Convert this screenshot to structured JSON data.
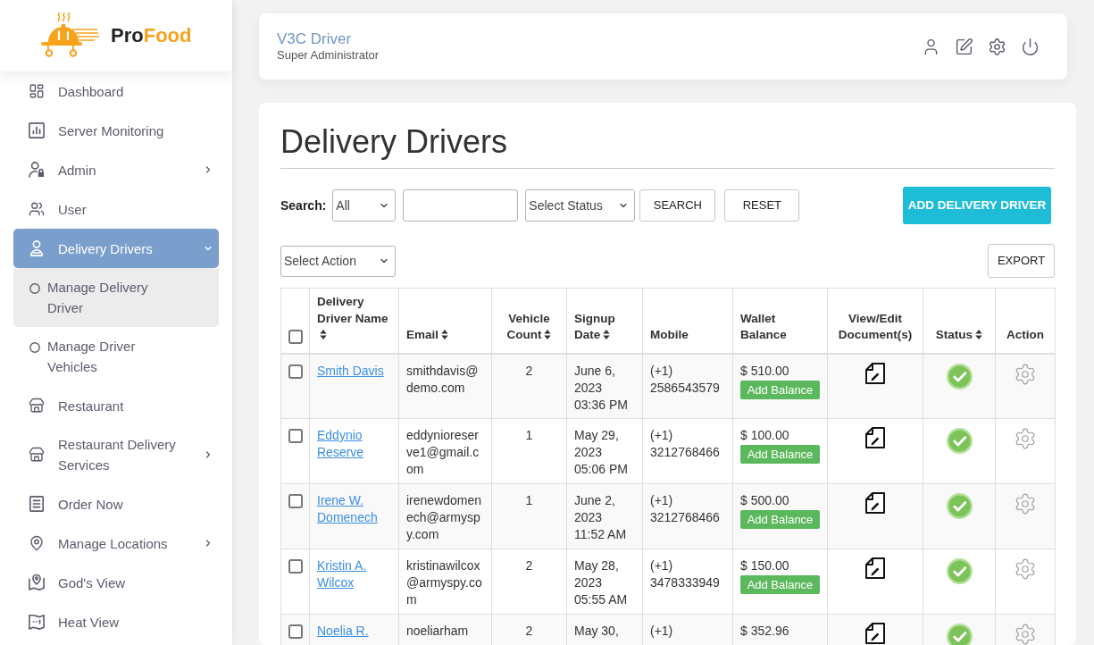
{
  "sidebar": {
    "logo": {
      "text_dark": "Pro",
      "text_accent": "Food"
    },
    "items": [
      {
        "label": "Dashboard",
        "selected": false
      },
      {
        "label": "Server Monitoring",
        "selected": false
      },
      {
        "label": "Admin",
        "selected": false,
        "expanded": false
      },
      {
        "label": "User",
        "selected": false
      },
      {
        "label": "Delivery Drivers",
        "selected": true,
        "expanded": true,
        "children": [
          {
            "label": "Manage Delivery Driver",
            "selected": true
          },
          {
            "label": "Manage Driver Vehicles",
            "selected": false
          }
        ]
      },
      {
        "label": "Restaurant",
        "selected": false
      },
      {
        "label": "Restaurant Delivery Services",
        "selected": false,
        "expanded": false
      },
      {
        "label": "Order Now",
        "selected": false
      },
      {
        "label": "Manage Locations",
        "selected": false,
        "expanded": false
      },
      {
        "label": "God's View",
        "selected": false
      },
      {
        "label": "Heat View",
        "selected": false
      }
    ]
  },
  "header": {
    "user_name": "V3C Driver",
    "role": "Super Administrator"
  },
  "page": {
    "title": "Delivery Drivers",
    "search": {
      "label": "Search:",
      "field": "All",
      "status": "Select Status",
      "search_button": "SEARCH",
      "reset_button": "RESET"
    },
    "add_button": "ADD DELIVERY DRIVER",
    "bulk_action": "Select Action",
    "export_button": "EXPORT"
  },
  "table": {
    "select_all": {
      "checked": false
    },
    "columns": [
      {
        "label": "Delivery Driver Name",
        "sortable": true
      },
      {
        "label": "Email",
        "sortable": true
      },
      {
        "label": "Vehicle Count",
        "sortable": true
      },
      {
        "label": "Signup Date",
        "sortable": true
      },
      {
        "label": "Mobile",
        "sortable": false
      },
      {
        "label": "Wallet Balance",
        "sortable": false
      },
      {
        "label": "View/Edit Document(s)",
        "sortable": false
      },
      {
        "label": "Status",
        "sortable": true
      },
      {
        "label": "Action",
        "sortable": false
      }
    ],
    "rows": [
      {
        "checked": false,
        "name": "Smith Davis",
        "email": "smithdavis@demo.com",
        "vehicle_count": "2",
        "signup_date": "June 6, 2023 03:36 PM",
        "mobile": "(+1) 2586543579",
        "wallet_balance": "$ 510.00",
        "add_balance": "Add Balance",
        "active": true
      },
      {
        "checked": false,
        "name": "Eddynio Reserve",
        "email": "eddynioreserve1@gmail.com",
        "vehicle_count": "1",
        "signup_date": "May 29, 2023 05:06 PM",
        "mobile": "(+1) 3212768466",
        "wallet_balance": "$ 100.00",
        "add_balance": "Add Balance",
        "active": true
      },
      {
        "checked": false,
        "name": "Irene W. Domenech",
        "email": "irenewdomenech@armyspy.com",
        "vehicle_count": "1",
        "signup_date": "June 2, 2023 11:52 AM",
        "mobile": "(+1) 3212768466",
        "wallet_balance": "$ 500.00",
        "add_balance": "Add Balance",
        "active": true
      },
      {
        "checked": false,
        "name": "Kristin A. Wilcox",
        "email": "kristinawilcox@armyspy.com",
        "vehicle_count": "2",
        "signup_date": "May 28, 2023 05:55 AM",
        "mobile": "(+1) 3478333949",
        "wallet_balance": "$ 150.00",
        "add_balance": "Add Balance",
        "active": true
      },
      {
        "checked": false,
        "name": "Noelia R.",
        "email": "noeliarham",
        "vehicle_count": "2",
        "signup_date": "May 30,",
        "mobile": "(+1)",
        "wallet_balance": "$ 352.96",
        "active": true
      }
    ]
  }
}
